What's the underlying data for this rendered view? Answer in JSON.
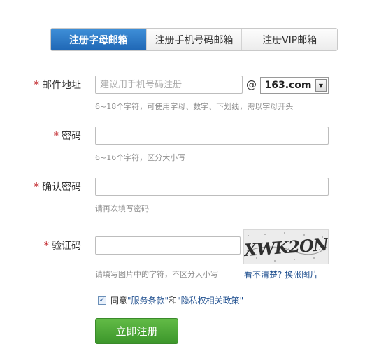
{
  "tabs": [
    {
      "label": "注册字母邮箱",
      "active": true
    },
    {
      "label": "注册手机号码邮箱",
      "active": false
    },
    {
      "label": "注册VIP邮箱",
      "active": false
    }
  ],
  "form": {
    "required_mark": "*",
    "email": {
      "label": "邮件地址",
      "placeholder": "建议用手机号码注册",
      "value": "",
      "at": "@",
      "domain": "163.com",
      "hint": "6~18个字符，可使用字母、数字、下划线，需以字母开头"
    },
    "password": {
      "label": "密码",
      "value": "",
      "hint": "6~16个字符，区分大小写"
    },
    "confirm": {
      "label": "确认密码",
      "value": "",
      "hint": "请再次填写密码"
    },
    "captcha": {
      "label": "验证码",
      "value": "",
      "image_text": "XWK2ON",
      "hint": "请填写图片中的字符，不区分大小写",
      "unclear": "看不清楚?",
      "change": "换张图片"
    },
    "agree": {
      "checked": true,
      "check_glyph": "✓",
      "prefix": "同意",
      "terms": "\"服务条款\"",
      "and": "和",
      "privacy": "\"隐私权相关政策\""
    },
    "submit_label": "立即注册"
  },
  "colors": {
    "tab_active": "#2b78c5",
    "required": "#c1272d",
    "link": "#1f4f8f",
    "submit": "#4caa35"
  }
}
